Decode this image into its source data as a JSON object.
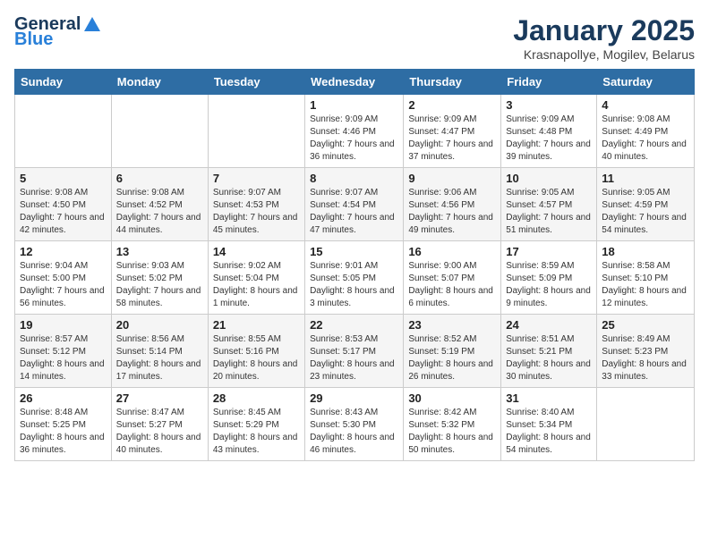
{
  "header": {
    "logo_general": "General",
    "logo_blue": "Blue",
    "month_title": "January 2025",
    "location": "Krasnapollye, Mogilev, Belarus"
  },
  "weekdays": [
    "Sunday",
    "Monday",
    "Tuesday",
    "Wednesday",
    "Thursday",
    "Friday",
    "Saturday"
  ],
  "weeks": [
    [
      {
        "day": "",
        "info": ""
      },
      {
        "day": "",
        "info": ""
      },
      {
        "day": "",
        "info": ""
      },
      {
        "day": "1",
        "info": "Sunrise: 9:09 AM\nSunset: 4:46 PM\nDaylight: 7 hours and 36 minutes."
      },
      {
        "day": "2",
        "info": "Sunrise: 9:09 AM\nSunset: 4:47 PM\nDaylight: 7 hours and 37 minutes."
      },
      {
        "day": "3",
        "info": "Sunrise: 9:09 AM\nSunset: 4:48 PM\nDaylight: 7 hours and 39 minutes."
      },
      {
        "day": "4",
        "info": "Sunrise: 9:08 AM\nSunset: 4:49 PM\nDaylight: 7 hours and 40 minutes."
      }
    ],
    [
      {
        "day": "5",
        "info": "Sunrise: 9:08 AM\nSunset: 4:50 PM\nDaylight: 7 hours and 42 minutes."
      },
      {
        "day": "6",
        "info": "Sunrise: 9:08 AM\nSunset: 4:52 PM\nDaylight: 7 hours and 44 minutes."
      },
      {
        "day": "7",
        "info": "Sunrise: 9:07 AM\nSunset: 4:53 PM\nDaylight: 7 hours and 45 minutes."
      },
      {
        "day": "8",
        "info": "Sunrise: 9:07 AM\nSunset: 4:54 PM\nDaylight: 7 hours and 47 minutes."
      },
      {
        "day": "9",
        "info": "Sunrise: 9:06 AM\nSunset: 4:56 PM\nDaylight: 7 hours and 49 minutes."
      },
      {
        "day": "10",
        "info": "Sunrise: 9:05 AM\nSunset: 4:57 PM\nDaylight: 7 hours and 51 minutes."
      },
      {
        "day": "11",
        "info": "Sunrise: 9:05 AM\nSunset: 4:59 PM\nDaylight: 7 hours and 54 minutes."
      }
    ],
    [
      {
        "day": "12",
        "info": "Sunrise: 9:04 AM\nSunset: 5:00 PM\nDaylight: 7 hours and 56 minutes."
      },
      {
        "day": "13",
        "info": "Sunrise: 9:03 AM\nSunset: 5:02 PM\nDaylight: 7 hours and 58 minutes."
      },
      {
        "day": "14",
        "info": "Sunrise: 9:02 AM\nSunset: 5:04 PM\nDaylight: 8 hours and 1 minute."
      },
      {
        "day": "15",
        "info": "Sunrise: 9:01 AM\nSunset: 5:05 PM\nDaylight: 8 hours and 3 minutes."
      },
      {
        "day": "16",
        "info": "Sunrise: 9:00 AM\nSunset: 5:07 PM\nDaylight: 8 hours and 6 minutes."
      },
      {
        "day": "17",
        "info": "Sunrise: 8:59 AM\nSunset: 5:09 PM\nDaylight: 8 hours and 9 minutes."
      },
      {
        "day": "18",
        "info": "Sunrise: 8:58 AM\nSunset: 5:10 PM\nDaylight: 8 hours and 12 minutes."
      }
    ],
    [
      {
        "day": "19",
        "info": "Sunrise: 8:57 AM\nSunset: 5:12 PM\nDaylight: 8 hours and 14 minutes."
      },
      {
        "day": "20",
        "info": "Sunrise: 8:56 AM\nSunset: 5:14 PM\nDaylight: 8 hours and 17 minutes."
      },
      {
        "day": "21",
        "info": "Sunrise: 8:55 AM\nSunset: 5:16 PM\nDaylight: 8 hours and 20 minutes."
      },
      {
        "day": "22",
        "info": "Sunrise: 8:53 AM\nSunset: 5:17 PM\nDaylight: 8 hours and 23 minutes."
      },
      {
        "day": "23",
        "info": "Sunrise: 8:52 AM\nSunset: 5:19 PM\nDaylight: 8 hours and 26 minutes."
      },
      {
        "day": "24",
        "info": "Sunrise: 8:51 AM\nSunset: 5:21 PM\nDaylight: 8 hours and 30 minutes."
      },
      {
        "day": "25",
        "info": "Sunrise: 8:49 AM\nSunset: 5:23 PM\nDaylight: 8 hours and 33 minutes."
      }
    ],
    [
      {
        "day": "26",
        "info": "Sunrise: 8:48 AM\nSunset: 5:25 PM\nDaylight: 8 hours and 36 minutes."
      },
      {
        "day": "27",
        "info": "Sunrise: 8:47 AM\nSunset: 5:27 PM\nDaylight: 8 hours and 40 minutes."
      },
      {
        "day": "28",
        "info": "Sunrise: 8:45 AM\nSunset: 5:29 PM\nDaylight: 8 hours and 43 minutes."
      },
      {
        "day": "29",
        "info": "Sunrise: 8:43 AM\nSunset: 5:30 PM\nDaylight: 8 hours and 46 minutes."
      },
      {
        "day": "30",
        "info": "Sunrise: 8:42 AM\nSunset: 5:32 PM\nDaylight: 8 hours and 50 minutes."
      },
      {
        "day": "31",
        "info": "Sunrise: 8:40 AM\nSunset: 5:34 PM\nDaylight: 8 hours and 54 minutes."
      },
      {
        "day": "",
        "info": ""
      }
    ]
  ]
}
